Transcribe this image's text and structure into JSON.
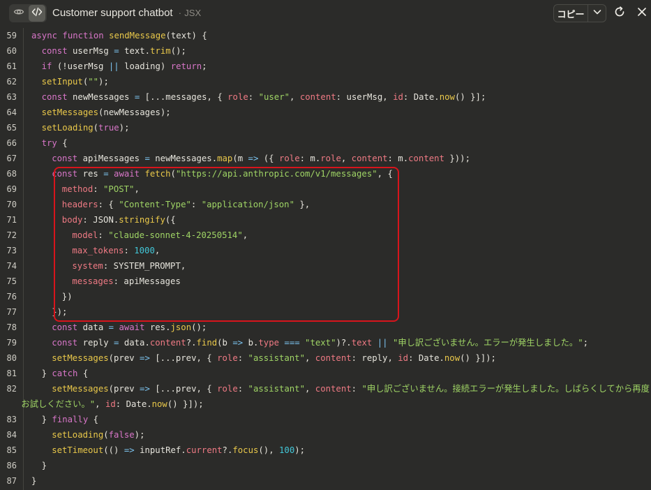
{
  "header": {
    "title": "Customer support chatbot",
    "separator": "·",
    "language": "JSX",
    "copy_label": "コピー",
    "icons": [
      "eye-icon",
      "code-icon",
      "chevron-down-icon",
      "refresh-icon",
      "close-icon"
    ]
  },
  "colors": {
    "background": "#2b2b29",
    "keyword": "#d876c8",
    "function": "#e9c84a",
    "string": "#9fd465",
    "property": "#ef7a84",
    "number": "#42c7d8",
    "highlight_border": "#d8141c"
  },
  "highlight": {
    "from_line": 68,
    "to_line": 77
  },
  "code": {
    "lines": [
      {
        "num": "59",
        "indent": 1,
        "tokens": [
          [
            "k",
            "async "
          ],
          [
            "k",
            "function "
          ],
          [
            "f",
            "sendMessage"
          ],
          [
            "t",
            "(text) {"
          ]
        ]
      },
      {
        "num": "60",
        "indent": 2,
        "tokens": [
          [
            "k",
            "const "
          ],
          [
            "t",
            "userMsg "
          ],
          [
            "o",
            "= "
          ],
          [
            "t",
            "text."
          ],
          [
            "f",
            "trim"
          ],
          [
            "t",
            "();"
          ]
        ]
      },
      {
        "num": "61",
        "indent": 2,
        "tokens": [
          [
            "k",
            "if "
          ],
          [
            "t",
            "(!userMsg "
          ],
          [
            "o",
            "|| "
          ],
          [
            "t",
            "loading) "
          ],
          [
            "k",
            "return"
          ],
          [
            "t",
            ";"
          ]
        ]
      },
      {
        "num": "62",
        "indent": 2,
        "tokens": [
          [
            "f",
            "setInput"
          ],
          [
            "t",
            "("
          ],
          [
            "s",
            "\"\""
          ],
          [
            "t",
            ");"
          ]
        ]
      },
      {
        "num": "63",
        "indent": 2,
        "tokens": [
          [
            "k",
            "const "
          ],
          [
            "t",
            "newMessages "
          ],
          [
            "o",
            "= "
          ],
          [
            "t",
            "[...messages, { "
          ],
          [
            "p",
            "role"
          ],
          [
            "t",
            ": "
          ],
          [
            "s",
            "\"user\""
          ],
          [
            "t",
            ", "
          ],
          [
            "p",
            "content"
          ],
          [
            "t",
            ": userMsg, "
          ],
          [
            "p",
            "id"
          ],
          [
            "t",
            ": Date."
          ],
          [
            "f",
            "now"
          ],
          [
            "t",
            "() }];"
          ]
        ]
      },
      {
        "num": "64",
        "indent": 2,
        "tokens": [
          [
            "f",
            "setMessages"
          ],
          [
            "t",
            "(newMessages);"
          ]
        ]
      },
      {
        "num": "65",
        "indent": 2,
        "tokens": [
          [
            "f",
            "setLoading"
          ],
          [
            "t",
            "("
          ],
          [
            "k",
            "true"
          ],
          [
            "t",
            ");"
          ]
        ]
      },
      {
        "num": "66",
        "indent": 2,
        "tokens": [
          [
            "k",
            "try "
          ],
          [
            "t",
            "{"
          ]
        ]
      },
      {
        "num": "67",
        "indent": 3,
        "tokens": [
          [
            "k",
            "const "
          ],
          [
            "t",
            "apiMessages "
          ],
          [
            "o",
            "= "
          ],
          [
            "t",
            "newMessages."
          ],
          [
            "f",
            "map"
          ],
          [
            "t",
            "(m "
          ],
          [
            "o",
            "=> "
          ],
          [
            "t",
            "({ "
          ],
          [
            "p",
            "role"
          ],
          [
            "t",
            ": m."
          ],
          [
            "p",
            "role"
          ],
          [
            "t",
            ", "
          ],
          [
            "p",
            "content"
          ],
          [
            "t",
            ": m."
          ],
          [
            "p",
            "content"
          ],
          [
            "t",
            " }));"
          ]
        ]
      },
      {
        "num": "68",
        "indent": 3,
        "tokens": [
          [
            "k",
            "const "
          ],
          [
            "t",
            "res "
          ],
          [
            "o",
            "= "
          ],
          [
            "k",
            "await "
          ],
          [
            "f",
            "fetch"
          ],
          [
            "t",
            "("
          ],
          [
            "s",
            "\"https://api.anthropic.com/v1/messages\""
          ],
          [
            "t",
            ", {"
          ]
        ]
      },
      {
        "num": "69",
        "indent": 4,
        "tokens": [
          [
            "p",
            "method"
          ],
          [
            "t",
            ": "
          ],
          [
            "s",
            "\"POST\""
          ],
          [
            "t",
            ","
          ]
        ]
      },
      {
        "num": "70",
        "indent": 4,
        "tokens": [
          [
            "p",
            "headers"
          ],
          [
            "t",
            ": { "
          ],
          [
            "s",
            "\"Content-Type\""
          ],
          [
            "t",
            ": "
          ],
          [
            "s",
            "\"application/json\""
          ],
          [
            "t",
            " },"
          ]
        ]
      },
      {
        "num": "71",
        "indent": 4,
        "tokens": [
          [
            "p",
            "body"
          ],
          [
            "t",
            ": JSON."
          ],
          [
            "f",
            "stringify"
          ],
          [
            "t",
            "({"
          ]
        ]
      },
      {
        "num": "72",
        "indent": 5,
        "tokens": [
          [
            "p",
            "model"
          ],
          [
            "t",
            ": "
          ],
          [
            "s",
            "\"claude-sonnet-4-20250514\""
          ],
          [
            "t",
            ","
          ]
        ]
      },
      {
        "num": "73",
        "indent": 5,
        "tokens": [
          [
            "p",
            "max_tokens"
          ],
          [
            "t",
            ": "
          ],
          [
            "n",
            "1000"
          ],
          [
            "t",
            ","
          ]
        ]
      },
      {
        "num": "74",
        "indent": 5,
        "tokens": [
          [
            "p",
            "system"
          ],
          [
            "t",
            ": SYSTEM_PROMPT,"
          ]
        ]
      },
      {
        "num": "75",
        "indent": 5,
        "tokens": [
          [
            "p",
            "messages"
          ],
          [
            "t",
            ": apiMessages"
          ]
        ]
      },
      {
        "num": "76",
        "indent": 4,
        "tokens": [
          [
            "t",
            "})"
          ]
        ]
      },
      {
        "num": "77",
        "indent": 3,
        "tokens": [
          [
            "t",
            "});"
          ]
        ]
      },
      {
        "num": "78",
        "indent": 3,
        "tokens": [
          [
            "k",
            "const "
          ],
          [
            "t",
            "data "
          ],
          [
            "o",
            "= "
          ],
          [
            "k",
            "await "
          ],
          [
            "t",
            "res."
          ],
          [
            "f",
            "json"
          ],
          [
            "t",
            "();"
          ]
        ]
      },
      {
        "num": "79",
        "indent": 3,
        "tokens": [
          [
            "k",
            "const "
          ],
          [
            "t",
            "reply "
          ],
          [
            "o",
            "= "
          ],
          [
            "t",
            "data."
          ],
          [
            "p",
            "content"
          ],
          [
            "t",
            "?."
          ],
          [
            "f",
            "find"
          ],
          [
            "t",
            "(b "
          ],
          [
            "o",
            "=> "
          ],
          [
            "t",
            "b."
          ],
          [
            "p",
            "type "
          ],
          [
            "o",
            "=== "
          ],
          [
            "s",
            "\"text\""
          ],
          [
            "t",
            ")?."
          ],
          [
            "p",
            "text "
          ],
          [
            "o",
            "|| "
          ],
          [
            "s",
            "\"申し訳ございません。エラーが発生しました。\""
          ],
          [
            "t",
            ";"
          ]
        ]
      },
      {
        "num": "80",
        "indent": 3,
        "tokens": [
          [
            "f",
            "setMessages"
          ],
          [
            "t",
            "(prev "
          ],
          [
            "o",
            "=> "
          ],
          [
            "t",
            "[...prev, { "
          ],
          [
            "p",
            "role"
          ],
          [
            "t",
            ": "
          ],
          [
            "s",
            "\"assistant\""
          ],
          [
            "t",
            ", "
          ],
          [
            "p",
            "content"
          ],
          [
            "t",
            ": reply, "
          ],
          [
            "p",
            "id"
          ],
          [
            "t",
            ": Date."
          ],
          [
            "f",
            "now"
          ],
          [
            "t",
            "() }]);"
          ]
        ]
      },
      {
        "num": "81",
        "indent": 2,
        "tokens": [
          [
            "t",
            "} "
          ],
          [
            "k",
            "catch "
          ],
          [
            "t",
            "{"
          ]
        ]
      },
      {
        "num": "82",
        "indent": 3,
        "tokens": [
          [
            "f",
            "setMessages"
          ],
          [
            "t",
            "(prev "
          ],
          [
            "o",
            "=> "
          ],
          [
            "t",
            "[...prev, { "
          ],
          [
            "p",
            "role"
          ],
          [
            "t",
            ": "
          ],
          [
            "s",
            "\"assistant\""
          ],
          [
            "t",
            ", "
          ],
          [
            "p",
            "content"
          ],
          [
            "t",
            ": "
          ],
          [
            "s",
            "\"申し訳ございません。接続エラーが発生しました。しばらくしてから再度"
          ]
        ]
      },
      {
        "num": "",
        "indent": 0,
        "tokens": [
          [
            "s",
            "お試しください。\""
          ],
          [
            "t",
            ", "
          ],
          [
            "p",
            "id"
          ],
          [
            "t",
            ": Date."
          ],
          [
            "f",
            "now"
          ],
          [
            "t",
            "() }]);"
          ]
        ]
      },
      {
        "num": "83",
        "indent": 2,
        "tokens": [
          [
            "t",
            "} "
          ],
          [
            "k",
            "finally "
          ],
          [
            "t",
            "{"
          ]
        ]
      },
      {
        "num": "84",
        "indent": 3,
        "tokens": [
          [
            "f",
            "setLoading"
          ],
          [
            "t",
            "("
          ],
          [
            "k",
            "false"
          ],
          [
            "t",
            ");"
          ]
        ]
      },
      {
        "num": "85",
        "indent": 3,
        "tokens": [
          [
            "f",
            "setTimeout"
          ],
          [
            "t",
            "(() "
          ],
          [
            "o",
            "=> "
          ],
          [
            "t",
            "inputRef."
          ],
          [
            "p",
            "current"
          ],
          [
            "t",
            "?."
          ],
          [
            "f",
            "focus"
          ],
          [
            "t",
            "(), "
          ],
          [
            "n",
            "100"
          ],
          [
            "t",
            ");"
          ]
        ]
      },
      {
        "num": "86",
        "indent": 2,
        "tokens": [
          [
            "t",
            "}"
          ]
        ]
      },
      {
        "num": "87",
        "indent": 1,
        "tokens": [
          [
            "t",
            "}"
          ]
        ]
      }
    ]
  }
}
